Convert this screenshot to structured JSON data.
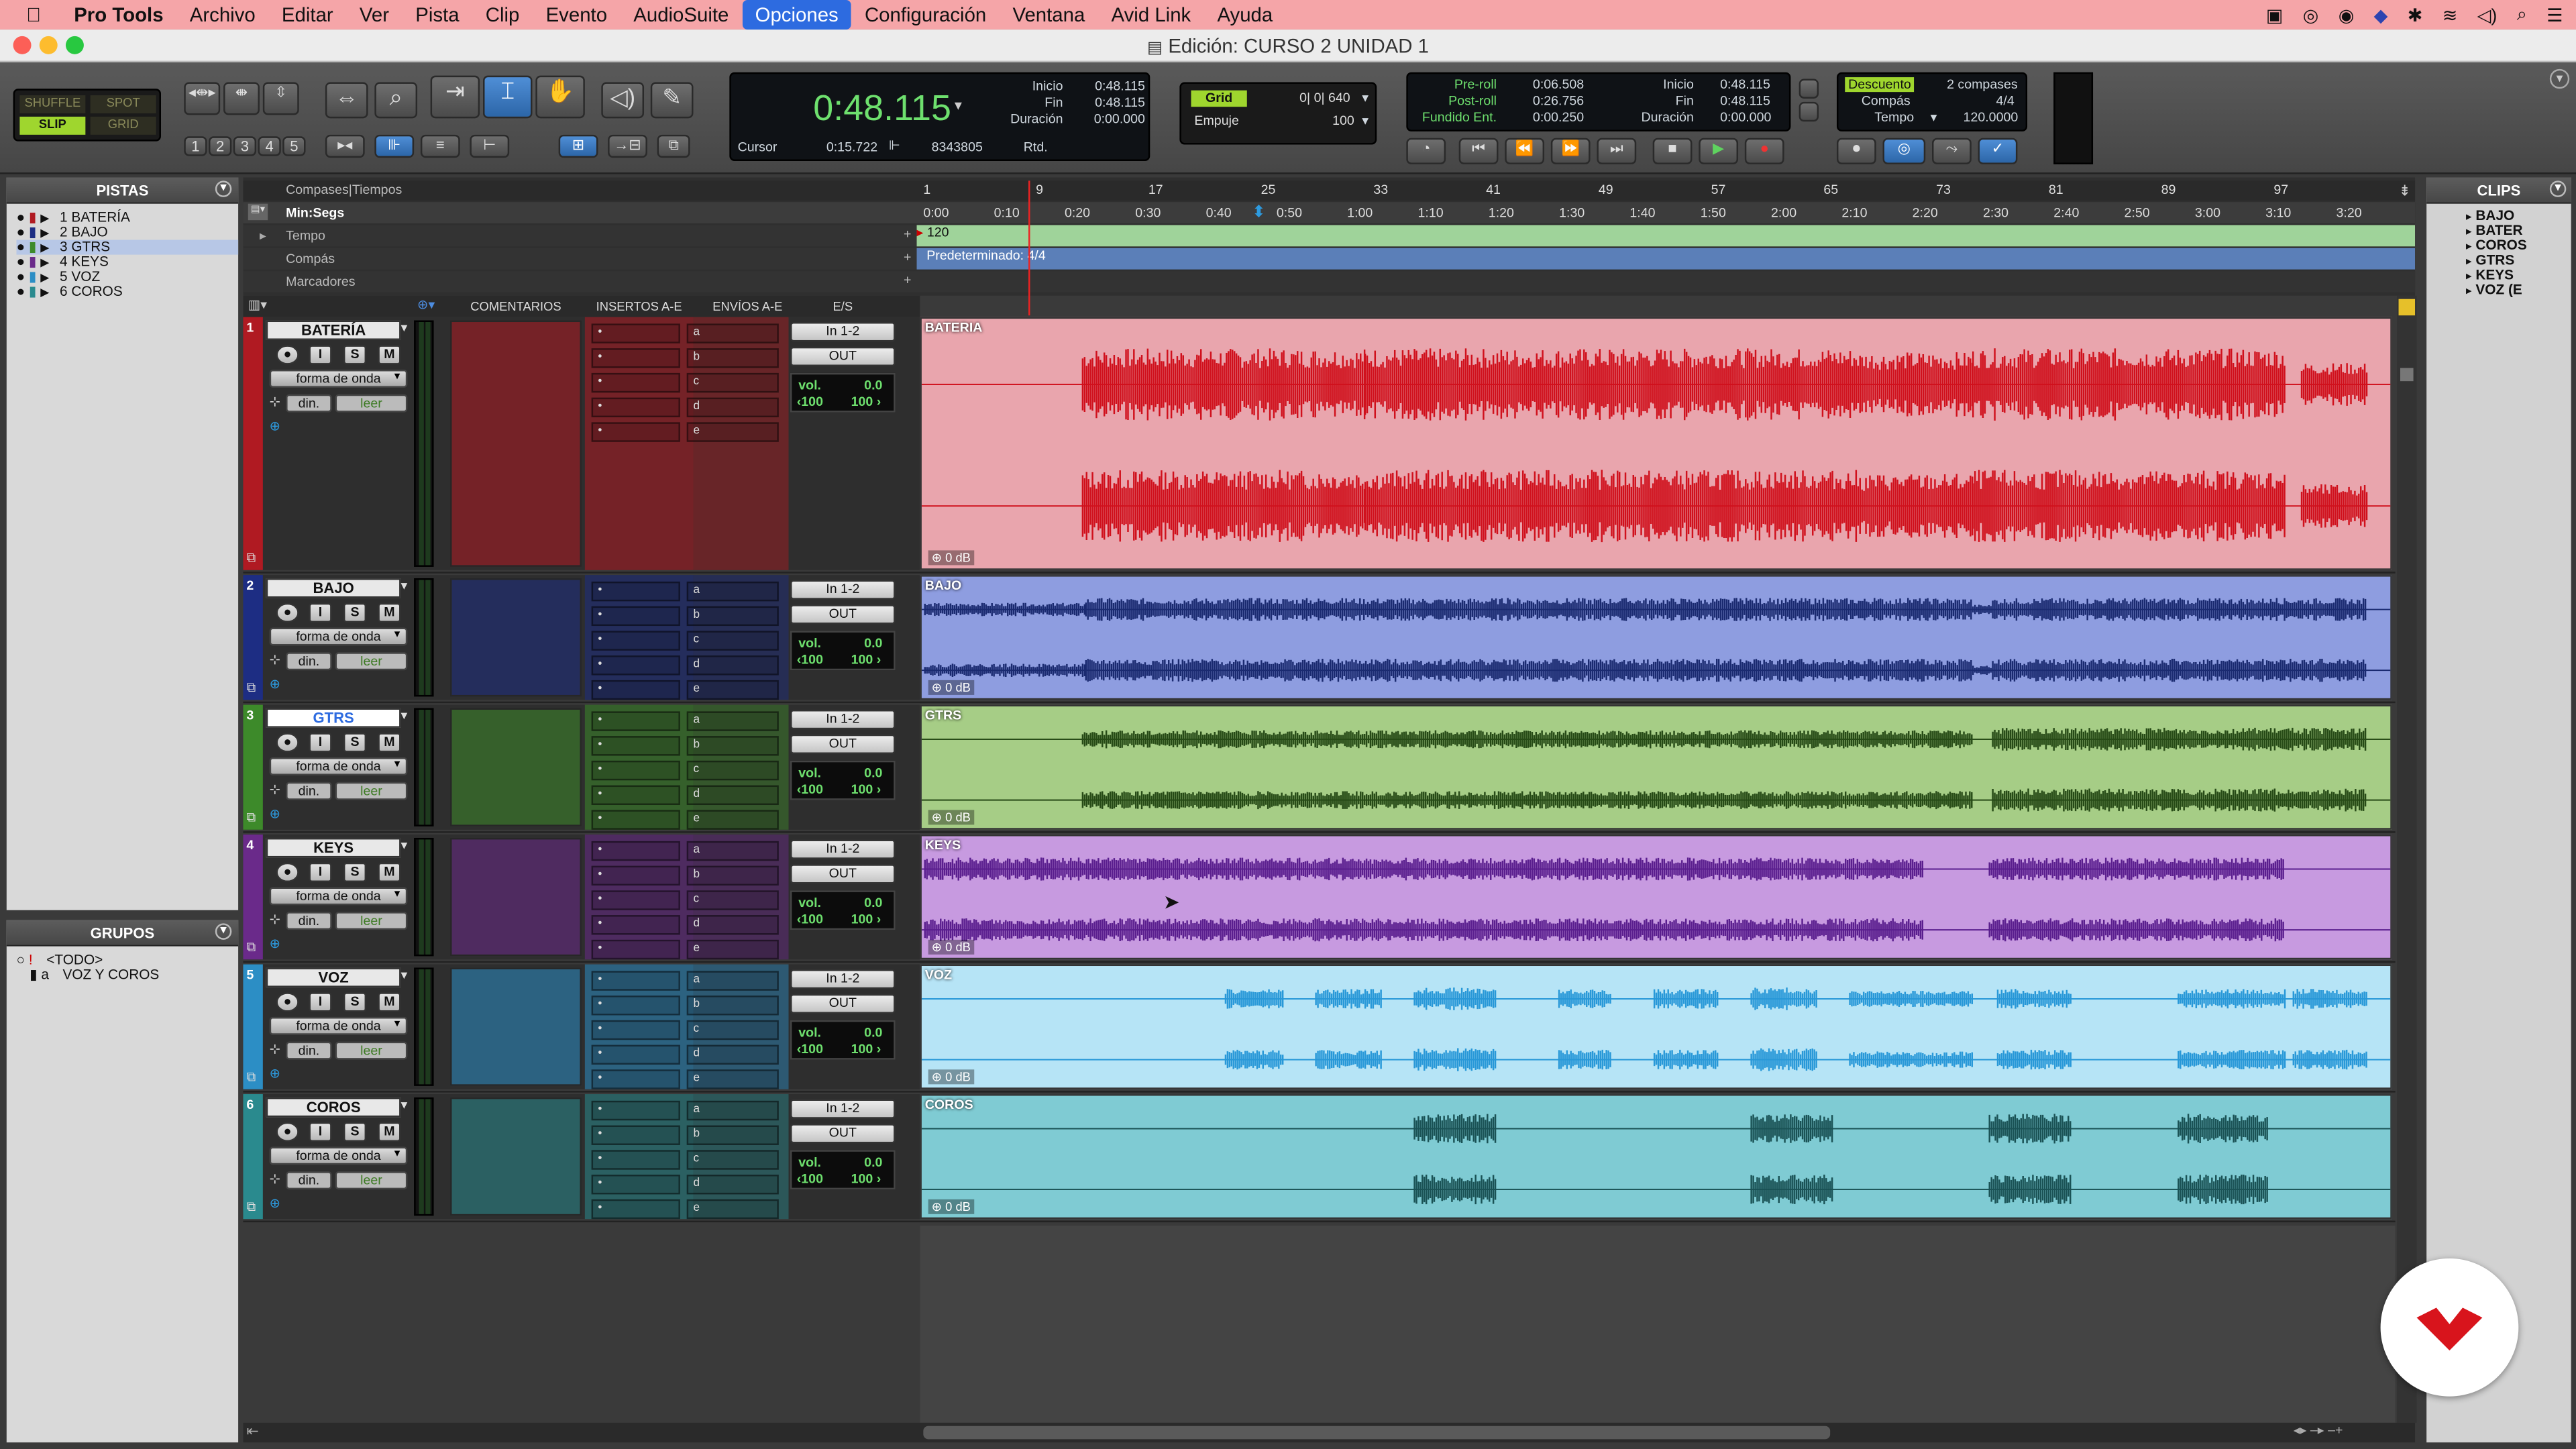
{
  "menubar": {
    "apple": "",
    "items": [
      "Pro Tools",
      "Archivo",
      "Editar",
      "Ver",
      "Pista",
      "Clip",
      "Evento",
      "AudioSuite",
      "Opciones",
      "Configuración",
      "Ventana",
      "Avid Link",
      "Ayuda"
    ],
    "active": "Opciones"
  },
  "window": {
    "title": "Edición: CURSO 2 UNIDAD 1"
  },
  "modes": {
    "shuffle": "SHUFFLE",
    "spot": "SPOT",
    "slip": "SLIP",
    "grid": "GRID"
  },
  "zoom_presets": [
    "1",
    "2",
    "3",
    "4",
    "5"
  ],
  "counter": {
    "main": "0:48.115",
    "inicio_label": "Inicio",
    "inicio": "0:48.115",
    "fin_label": "Fin",
    "fin": "0:48.115",
    "duracion_label": "Duración",
    "duracion": "0:00.000",
    "cursor_label": "Cursor",
    "cursor": "0:15.722",
    "sample": "8343805",
    "rtd": "Rtd."
  },
  "grid": {
    "label": "Grid",
    "value": "0| 0| 640",
    "nudge_label": "Empuje",
    "nudge": "100"
  },
  "transport_counters": {
    "preroll_label": "Pre-roll",
    "preroll": "0:06.508",
    "postroll_label": "Post-roll",
    "postroll": "0:26.756",
    "fade_label": "Fundido Ent.",
    "fade": "0:00.250",
    "inicio_label": "Inicio",
    "inicio": "0:48.115",
    "fin_label": "Fin",
    "fin": "0:48.115",
    "duracion_label": "Duración",
    "duracion": "0:00.000"
  },
  "countoff": {
    "label": "Descuento",
    "value": "2 compases",
    "meter_label": "Compás",
    "meter": "4/4",
    "tempo_label": "Tempo",
    "tempo": "120.0000"
  },
  "pistas": {
    "title": "PISTAS",
    "items": [
      "1 BATERÍA",
      "2 BAJO",
      "3 GTRS",
      "4 KEYS",
      "5 VOZ",
      "6 COROS"
    ],
    "selected": 2
  },
  "grupos": {
    "title": "GRUPOS",
    "items": [
      "<TODO>",
      "VOZ Y COROS"
    ],
    "marker": "a"
  },
  "clips": {
    "title": "CLIPS",
    "items": [
      "BAJO",
      "BATER",
      "COROS",
      "GTRS",
      "KEYS",
      "VOZ (E"
    ]
  },
  "rulers": {
    "bars_label": "Compases|Tiempos",
    "minsecs_label": "Min:Segs",
    "tempo_label": "Tempo",
    "meter_label": "Compás",
    "markers_label": "Marcadores",
    "tempo_value": "120",
    "meter_value": "Predeterminado: 4/4",
    "bars": [
      "1",
      "9",
      "17",
      "25",
      "33",
      "41",
      "49",
      "57",
      "65",
      "73",
      "81",
      "89",
      "97"
    ],
    "times": [
      "0:00",
      "0:10",
      "0:20",
      "0:30",
      "0:40",
      "0:50",
      "1:00",
      "1:10",
      "1:20",
      "1:30",
      "1:40",
      "1:50",
      "2:00",
      "2:10",
      "2:20",
      "2:30",
      "2:40",
      "2:50",
      "3:00",
      "3:10",
      "3:20"
    ]
  },
  "columns": {
    "comments": "COMENTARIOS",
    "inserts": "INSERTOS A-E",
    "sends": "ENVÍOS A-E",
    "io": "E/S"
  },
  "track_common": {
    "view": "forma de onda",
    "auto": "din.",
    "read": "leer",
    "input": "In 1-2",
    "output": "OUT",
    "vol_label": "vol.",
    "vol": "0.0",
    "pan_l": "‹100",
    "pan_r": "100 ›",
    "solo": "S",
    "mute": "M",
    "input_monitor": "I",
    "sends": [
      "a",
      "b",
      "c",
      "d",
      "e"
    ],
    "clip_gain": "0 dB"
  },
  "tracks": [
    {
      "num": "1",
      "name": "BATERÍA",
      "clip": "BATERIA",
      "color": "#b01a22",
      "clipbg": "#e9a5ad",
      "wave": "#d0101c"
    },
    {
      "num": "2",
      "name": "BAJO",
      "clip": "BAJO",
      "color": "#1d2d83",
      "clipbg": "#8e9de0",
      "wave": "#1a2a70"
    },
    {
      "num": "3",
      "name": "GTRS",
      "clip": "GTRS",
      "color": "#3d8a2a",
      "clipbg": "#a6cd86",
      "wave": "#264a16"
    },
    {
      "num": "4",
      "name": "KEYS",
      "clip": "KEYS",
      "color": "#6a2a8a",
      "clipbg": "#c79ae0",
      "wave": "#5a1e8e"
    },
    {
      "num": "5",
      "name": "VOZ",
      "clip": "VOZ",
      "color": "#2c8ec5",
      "clipbg": "#b6e4f6",
      "wave": "#2898d8"
    },
    {
      "num": "6",
      "name": "COROS",
      "clip": "COROS",
      "color": "#2a8a8e",
      "clipbg": "#7fcbd3",
      "wave": "#1a5255"
    }
  ],
  "colors": {
    "accent": "#2d6be0",
    "menubar": "#f5a5a8",
    "logo": "#d8141c"
  }
}
